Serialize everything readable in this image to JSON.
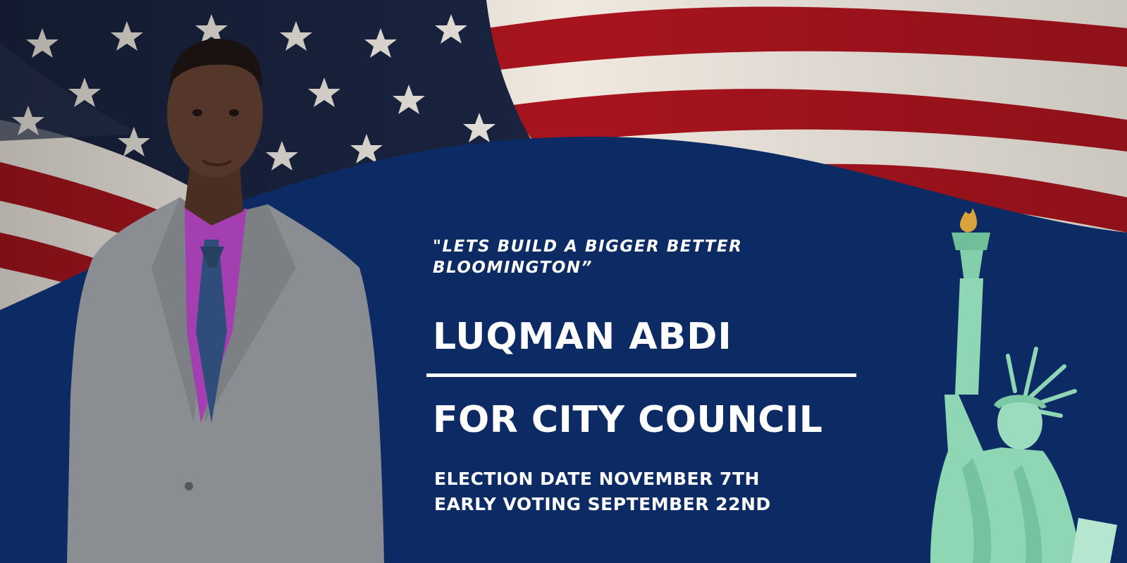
{
  "banner": {
    "quote": "\"LETS BUILD A BIGGER BETTER BLOOMINGTON”",
    "name": "LUQMAN ABDI",
    "office": "FOR CITY COUNCIL",
    "election_date": "ELECTION DATE NOVEMBER 7TH",
    "early_voting": "EARLY VOTING SEPTEMBER 22ND"
  },
  "images": {
    "background": "american-flag-photo",
    "candidate": "candidate-portrait-photo",
    "statue": "statue-of-liberty-illustration"
  },
  "colors": {
    "navy_panel": "#0c2a64",
    "flag_red": "#a8141e",
    "flag_white": "#efe9e0",
    "flag_blue": "#1a2440",
    "text": "#ffffff",
    "statue_green": "#8fd6b4",
    "suit_gray": "#8a8d91",
    "shirt_purple": "#a33fb1"
  }
}
